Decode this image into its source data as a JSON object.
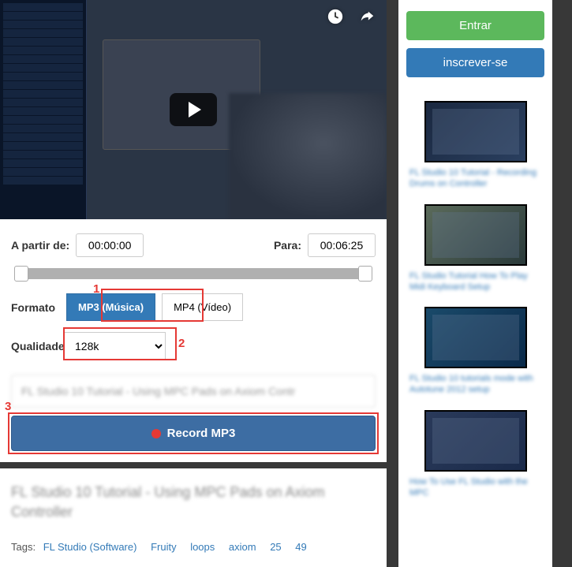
{
  "sidebar_buttons": {
    "login": "Entrar",
    "signup": "inscrever-se"
  },
  "time": {
    "from_label": "A partir de:",
    "from_value": "00:00:00",
    "to_label": "Para:",
    "to_value": "00:06:25"
  },
  "format": {
    "label": "Formato",
    "mp3": "MP3 (Música)",
    "mp4": "MP4 (Vídeo)"
  },
  "quality": {
    "label": "Qualidade",
    "selected": "128k"
  },
  "title_preview": "FL Studio 10 Tutorial - Using MPC Pads on Axiom Contr",
  "record_label": "Record MP3",
  "description_title": "FL Studio 10 Tutorial - Using MPC Pads on Axiom Controller",
  "tags_label": "Tags:",
  "tags": [
    "FL Studio (Software)",
    "Fruity",
    "loops",
    "axiom",
    "25",
    "49"
  ],
  "related": [
    {
      "title": "FL Studio 10 Tutorial - Recording Drums on Controller"
    },
    {
      "title": "FL Studio Tutorial How To Play Midi Keyboard Setup"
    },
    {
      "title": "FL Studio 10 tutorials mode with Autotune 2012 setup"
    },
    {
      "title": "How To Use FL Studio with the MPC"
    }
  ],
  "annotations": {
    "n1": "1",
    "n2": "2",
    "n3": "3"
  }
}
